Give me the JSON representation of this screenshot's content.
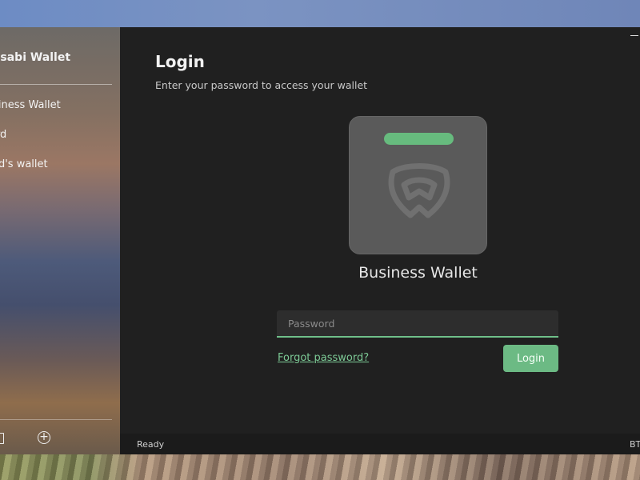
{
  "sidebar": {
    "title": "Wasabi Wallet",
    "items": [
      {
        "label": "Business Wallet"
      },
      {
        "label": "Board"
      },
      {
        "label": "Dad's wallet"
      }
    ],
    "bottom_icons": [
      "wallet-icon",
      "add-circle-icon"
    ]
  },
  "window_controls": {
    "minimize_icon": "minimize-icon"
  },
  "login": {
    "title": "Login",
    "subtitle": "Enter your password to access your wallet",
    "wallet_name": "Business Wallet",
    "password": {
      "value": "",
      "placeholder": "Password"
    },
    "forgot_label": "Forgot password?",
    "login_label": "Login"
  },
  "status_bar": {
    "status": "Ready",
    "right_text": "BTC"
  },
  "colors": {
    "accent": "#6cba84",
    "card_bar": "#67bb7e",
    "main_bg": "#202020",
    "card_bg": "#5a5a5a"
  }
}
